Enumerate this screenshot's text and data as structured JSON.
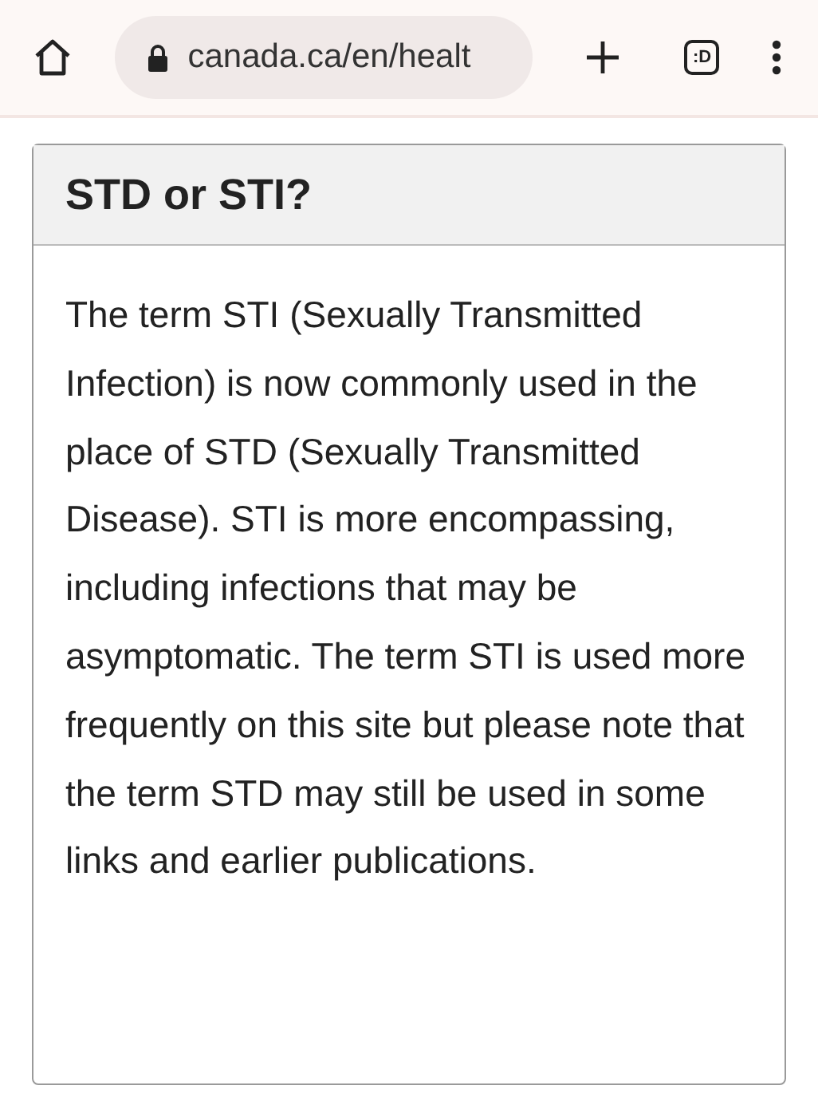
{
  "browser": {
    "url": "canada.ca/en/healt",
    "tab_count": ":D"
  },
  "panel": {
    "title": "STD or STI?",
    "body": "The term STI (Sexually Transmitted Infection) is now commonly used in the place of STD (Sexually Transmitted Disease). STI is more encompassing, including infections that may be asymptomatic. The term STI is used more frequently on this site but please note that the term STD may still be used in some links and earlier publications."
  }
}
